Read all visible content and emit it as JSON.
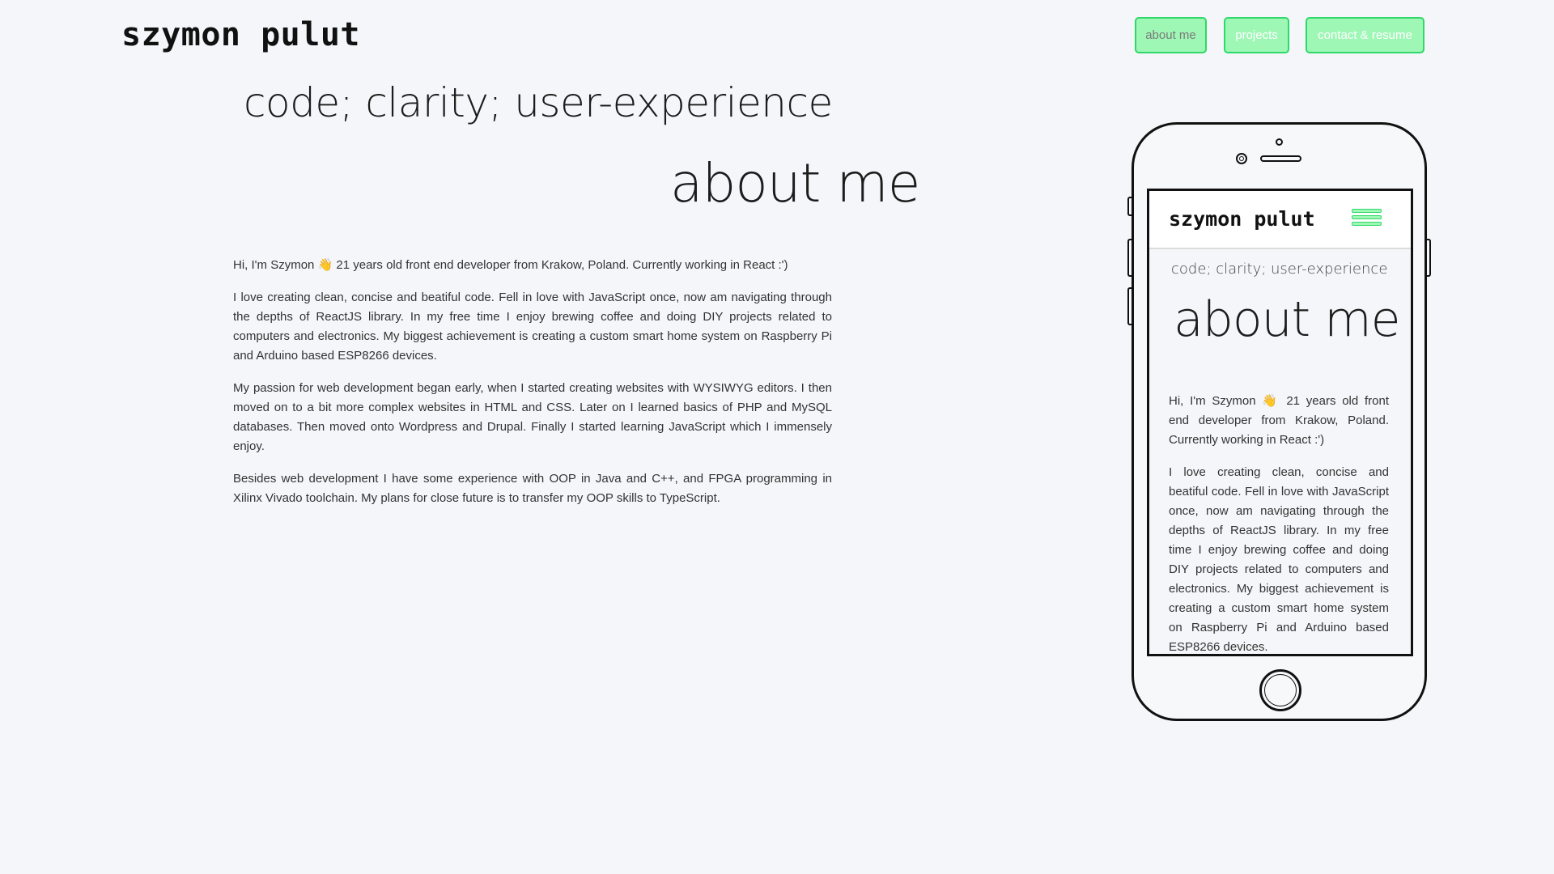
{
  "header": {
    "brand": "szymon pulut",
    "nav": [
      {
        "label": "about me",
        "active": true
      },
      {
        "label": "projects",
        "active": false
      },
      {
        "label": "contact & resume",
        "active": false
      }
    ]
  },
  "hero": {
    "tagline": "code; clarity; user-experience",
    "section_title": "about me"
  },
  "about": {
    "paragraphs": [
      "Hi, I'm Szymon 👋 21 years old front end developer from Krakow, Poland. Currently working in React :')",
      "I love creating clean, concise and beatiful code. Fell in love with JavaScript once, now am navigating through the depths of ReactJS library. In my free time I enjoy brewing coffee and doing DIY projects related to computers and electronics. My biggest achievement is creating a custom smart home system on Raspberry Pi and Arduino based ESP8266 devices.",
      "My passion for web development began early, when I started creating websites with WYSIWYG editors. I then moved on to a bit more complex websites in HTML and CSS. Later on I learned basics of PHP and MySQL databases. Then moved onto Wordpress and Drupal. Finally I started learning JavaScript which I immensely enjoy.",
      "Besides web development I have some experience with OOP in Java and C++, and FPGA programming in Xilinx Vivado toolchain. My plans for close future is to transfer my OOP skills to TypeScript."
    ]
  },
  "phone_preview": {
    "brand": "szymon pulut",
    "menu_icon": "hamburger-menu-icon",
    "tagline": "code; clarity; user-experience",
    "section_title": "about me",
    "paragraphs": [
      "Hi, I'm Szymon 👋 21 years old front end developer from Krakow, Poland. Currently working in React :')",
      "I love creating clean, concise and beatiful code. Fell in love with JavaScript once, now am navigating through the depths of ReactJS library. In my free time I enjoy brewing coffee and doing DIY projects related to computers and electronics. My biggest achievement is creating a custom smart home system on Raspberry Pi and Arduino based ESP8266 devices."
    ]
  },
  "colors": {
    "background": "#f4f6f9",
    "nav_fill": "#9ff7b6",
    "nav_border": "#2fd86a",
    "text": "#222222"
  }
}
